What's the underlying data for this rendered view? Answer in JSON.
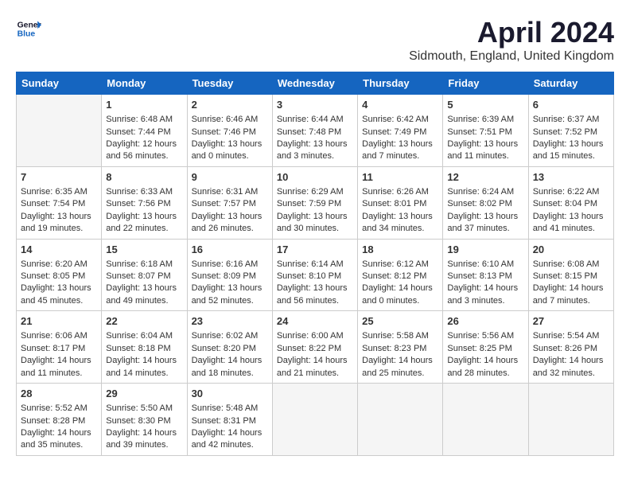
{
  "logo": {
    "line1": "General",
    "line2": "Blue"
  },
  "title": "April 2024",
  "subtitle": "Sidmouth, England, United Kingdom",
  "days": [
    "Sunday",
    "Monday",
    "Tuesday",
    "Wednesday",
    "Thursday",
    "Friday",
    "Saturday"
  ],
  "weeks": [
    [
      {
        "num": "",
        "sunrise": "",
        "sunset": "",
        "daylight": ""
      },
      {
        "num": "1",
        "sunrise": "Sunrise: 6:48 AM",
        "sunset": "Sunset: 7:44 PM",
        "daylight": "Daylight: 12 hours and 56 minutes."
      },
      {
        "num": "2",
        "sunrise": "Sunrise: 6:46 AM",
        "sunset": "Sunset: 7:46 PM",
        "daylight": "Daylight: 13 hours and 0 minutes."
      },
      {
        "num": "3",
        "sunrise": "Sunrise: 6:44 AM",
        "sunset": "Sunset: 7:48 PM",
        "daylight": "Daylight: 13 hours and 3 minutes."
      },
      {
        "num": "4",
        "sunrise": "Sunrise: 6:42 AM",
        "sunset": "Sunset: 7:49 PM",
        "daylight": "Daylight: 13 hours and 7 minutes."
      },
      {
        "num": "5",
        "sunrise": "Sunrise: 6:39 AM",
        "sunset": "Sunset: 7:51 PM",
        "daylight": "Daylight: 13 hours and 11 minutes."
      },
      {
        "num": "6",
        "sunrise": "Sunrise: 6:37 AM",
        "sunset": "Sunset: 7:52 PM",
        "daylight": "Daylight: 13 hours and 15 minutes."
      }
    ],
    [
      {
        "num": "7",
        "sunrise": "Sunrise: 6:35 AM",
        "sunset": "Sunset: 7:54 PM",
        "daylight": "Daylight: 13 hours and 19 minutes."
      },
      {
        "num": "8",
        "sunrise": "Sunrise: 6:33 AM",
        "sunset": "Sunset: 7:56 PM",
        "daylight": "Daylight: 13 hours and 22 minutes."
      },
      {
        "num": "9",
        "sunrise": "Sunrise: 6:31 AM",
        "sunset": "Sunset: 7:57 PM",
        "daylight": "Daylight: 13 hours and 26 minutes."
      },
      {
        "num": "10",
        "sunrise": "Sunrise: 6:29 AM",
        "sunset": "Sunset: 7:59 PM",
        "daylight": "Daylight: 13 hours and 30 minutes."
      },
      {
        "num": "11",
        "sunrise": "Sunrise: 6:26 AM",
        "sunset": "Sunset: 8:01 PM",
        "daylight": "Daylight: 13 hours and 34 minutes."
      },
      {
        "num": "12",
        "sunrise": "Sunrise: 6:24 AM",
        "sunset": "Sunset: 8:02 PM",
        "daylight": "Daylight: 13 hours and 37 minutes."
      },
      {
        "num": "13",
        "sunrise": "Sunrise: 6:22 AM",
        "sunset": "Sunset: 8:04 PM",
        "daylight": "Daylight: 13 hours and 41 minutes."
      }
    ],
    [
      {
        "num": "14",
        "sunrise": "Sunrise: 6:20 AM",
        "sunset": "Sunset: 8:05 PM",
        "daylight": "Daylight: 13 hours and 45 minutes."
      },
      {
        "num": "15",
        "sunrise": "Sunrise: 6:18 AM",
        "sunset": "Sunset: 8:07 PM",
        "daylight": "Daylight: 13 hours and 49 minutes."
      },
      {
        "num": "16",
        "sunrise": "Sunrise: 6:16 AM",
        "sunset": "Sunset: 8:09 PM",
        "daylight": "Daylight: 13 hours and 52 minutes."
      },
      {
        "num": "17",
        "sunrise": "Sunrise: 6:14 AM",
        "sunset": "Sunset: 8:10 PM",
        "daylight": "Daylight: 13 hours and 56 minutes."
      },
      {
        "num": "18",
        "sunrise": "Sunrise: 6:12 AM",
        "sunset": "Sunset: 8:12 PM",
        "daylight": "Daylight: 14 hours and 0 minutes."
      },
      {
        "num": "19",
        "sunrise": "Sunrise: 6:10 AM",
        "sunset": "Sunset: 8:13 PM",
        "daylight": "Daylight: 14 hours and 3 minutes."
      },
      {
        "num": "20",
        "sunrise": "Sunrise: 6:08 AM",
        "sunset": "Sunset: 8:15 PM",
        "daylight": "Daylight: 14 hours and 7 minutes."
      }
    ],
    [
      {
        "num": "21",
        "sunrise": "Sunrise: 6:06 AM",
        "sunset": "Sunset: 8:17 PM",
        "daylight": "Daylight: 14 hours and 11 minutes."
      },
      {
        "num": "22",
        "sunrise": "Sunrise: 6:04 AM",
        "sunset": "Sunset: 8:18 PM",
        "daylight": "Daylight: 14 hours and 14 minutes."
      },
      {
        "num": "23",
        "sunrise": "Sunrise: 6:02 AM",
        "sunset": "Sunset: 8:20 PM",
        "daylight": "Daylight: 14 hours and 18 minutes."
      },
      {
        "num": "24",
        "sunrise": "Sunrise: 6:00 AM",
        "sunset": "Sunset: 8:22 PM",
        "daylight": "Daylight: 14 hours and 21 minutes."
      },
      {
        "num": "25",
        "sunrise": "Sunrise: 5:58 AM",
        "sunset": "Sunset: 8:23 PM",
        "daylight": "Daylight: 14 hours and 25 minutes."
      },
      {
        "num": "26",
        "sunrise": "Sunrise: 5:56 AM",
        "sunset": "Sunset: 8:25 PM",
        "daylight": "Daylight: 14 hours and 28 minutes."
      },
      {
        "num": "27",
        "sunrise": "Sunrise: 5:54 AM",
        "sunset": "Sunset: 8:26 PM",
        "daylight": "Daylight: 14 hours and 32 minutes."
      }
    ],
    [
      {
        "num": "28",
        "sunrise": "Sunrise: 5:52 AM",
        "sunset": "Sunset: 8:28 PM",
        "daylight": "Daylight: 14 hours and 35 minutes."
      },
      {
        "num": "29",
        "sunrise": "Sunrise: 5:50 AM",
        "sunset": "Sunset: 8:30 PM",
        "daylight": "Daylight: 14 hours and 39 minutes."
      },
      {
        "num": "30",
        "sunrise": "Sunrise: 5:48 AM",
        "sunset": "Sunset: 8:31 PM",
        "daylight": "Daylight: 14 hours and 42 minutes."
      },
      {
        "num": "",
        "sunrise": "",
        "sunset": "",
        "daylight": ""
      },
      {
        "num": "",
        "sunrise": "",
        "sunset": "",
        "daylight": ""
      },
      {
        "num": "",
        "sunrise": "",
        "sunset": "",
        "daylight": ""
      },
      {
        "num": "",
        "sunrise": "",
        "sunset": "",
        "daylight": ""
      }
    ]
  ]
}
